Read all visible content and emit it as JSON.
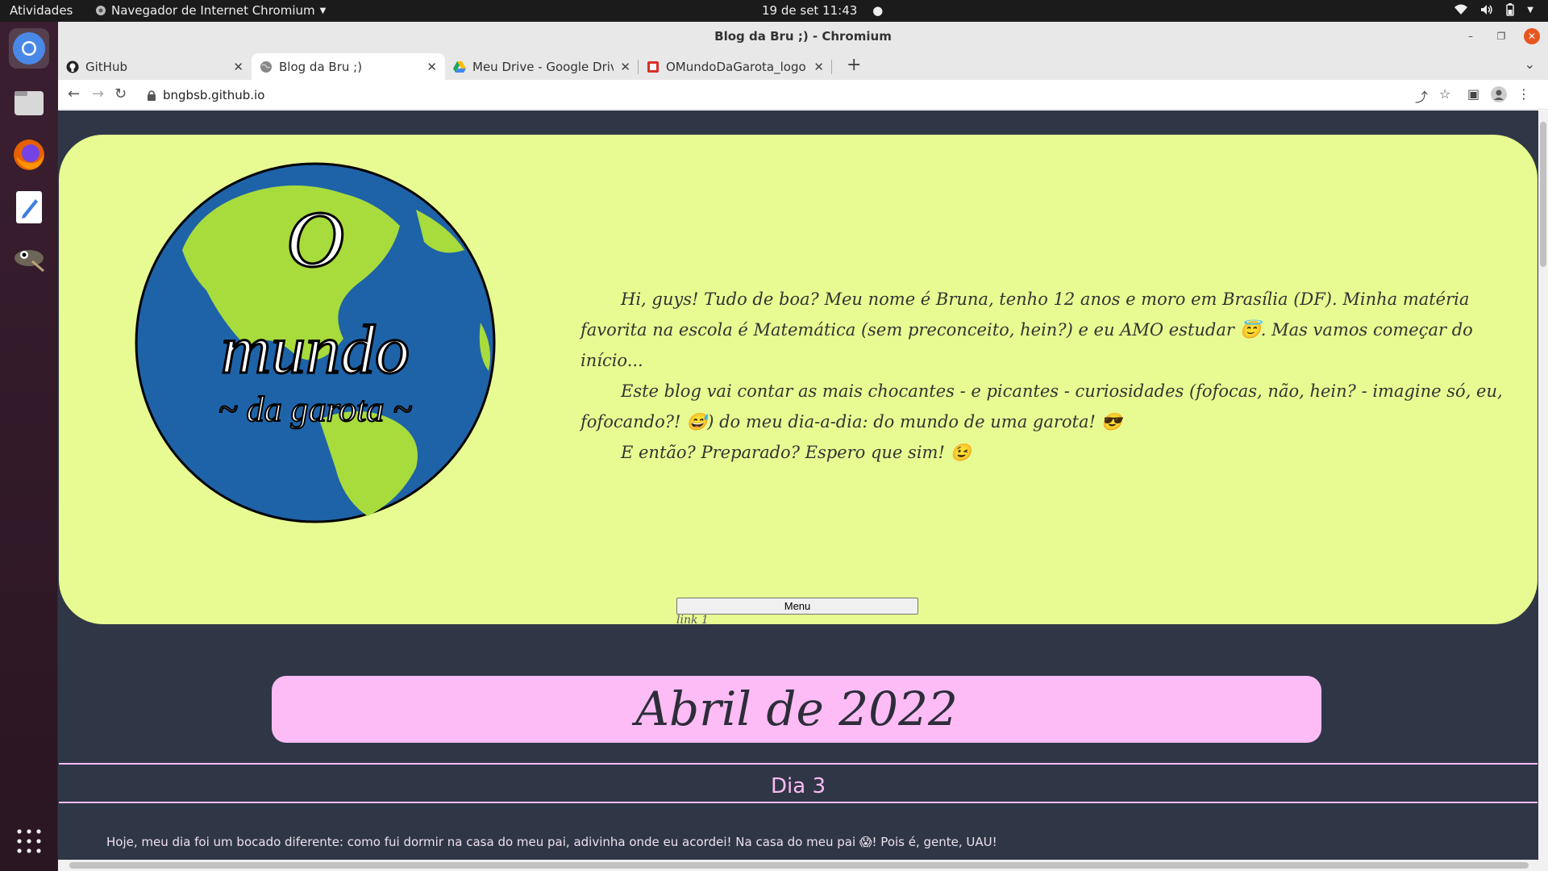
{
  "topbar": {
    "activities": "Atividades",
    "app_menu": "Navegador de Internet Chromium",
    "clock": "19 de set  11:43",
    "status_icons": [
      "wifi-icon",
      "volume-icon",
      "battery-icon",
      "chevron-down-icon"
    ]
  },
  "dock": {
    "items": [
      "chromium-icon",
      "files-icon",
      "firefox-icon",
      "text-editor-icon",
      "gimp-icon"
    ],
    "apps_grid_icon": "apps-grid-icon"
  },
  "window": {
    "title": "Blog da Bru ;) - Chromium"
  },
  "tabs": [
    {
      "title": "GitHub",
      "icon": "github-icon"
    },
    {
      "title": "Blog da Bru ;)",
      "icon": "globe-icon"
    },
    {
      "title": "Meu Drive - Google Drive",
      "icon": "google-drive-icon"
    },
    {
      "title": "OMundoDaGarota_logo -",
      "icon": "image-icon"
    }
  ],
  "toolbar": {
    "url": "bngbsb.github.io"
  },
  "page": {
    "intro_paragraphs": [
      "Hi, guys! Tudo de boa? Meu nome é Bruna, tenho 12 anos e moro em Brasília (DF). Minha matéria favorita na escola é Matemática (sem preconceito, hein?) e eu AMO estudar 😇. Mas vamos começar do início...",
      "Este blog vai contar as mais chocantes - e picantes - curiosidades (fofocas, não, hein? - imagine só, eu, fofocando?! 😅) do meu dia-a-dia: do mundo de uma garota! 😎",
      "E então? Preparado? Espero que sim! 😉"
    ],
    "logo": {
      "line1": "O",
      "line2": "mundo",
      "line3": "~ da garota ~"
    },
    "menu_button": "Menu",
    "link1": "link 1",
    "month_heading": "Abril de 2022",
    "day_heading": "Dia 3",
    "post_text": "Hoje, meu dia foi um bocado diferente: como fui dormir na casa do meu pai, adivinha onde eu acordei! Na casa do meu pai 😱! Pois é, gente, UAU!"
  },
  "colors": {
    "page_bg": "#2f3746",
    "header_card": "#e8fb92",
    "banner_pink": "#fdbcf5",
    "ocean": "#1e63a8",
    "land": "#a8db3c"
  }
}
